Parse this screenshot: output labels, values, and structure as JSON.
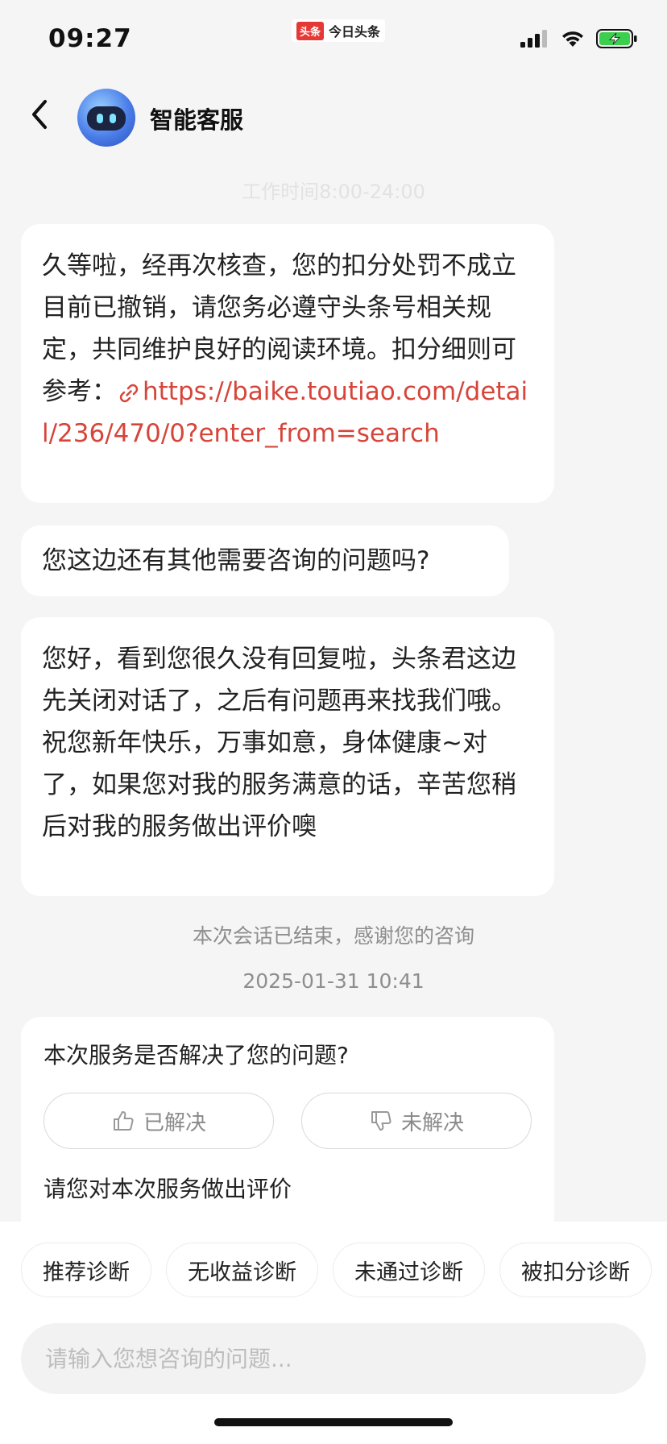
{
  "status_bar": {
    "time": "09:27",
    "app_badge_logo": "头条",
    "app_badge_name": "今日头条",
    "icons": [
      "signal-icon",
      "wifi-icon",
      "battery-charging-icon"
    ],
    "battery_color": "#3ccf4e"
  },
  "header": {
    "title": "智能客服",
    "back_icon": "chevron-left-icon",
    "avatar_icon": "robot-avatar-icon"
  },
  "faded_hint": "工作时间8:00-24:00",
  "messages": [
    {
      "text": "久等啦，经再次核查，您的扣分处罚不成立目前已撤销，请您务必遵守头条号相关规定，共同维护良好的阅读环境。扣分细则可参考：",
      "link": "https://baike.toutiao.com/detail/236/470/0?enter_from=search"
    },
    {
      "text": "您这边还有其他需要咨询的问题吗?"
    },
    {
      "text": "您好，看到您很久没有回复啦，头条君这边先关闭对话了，之后有问题再来找我们哦。祝您新年快乐，万事如意，身体健康~对了，如果您对我的服务满意的话，辛苦您稍后对我的服务做出评价噢"
    }
  ],
  "system": {
    "ended": "本次会话已结束，感谢您的咨询",
    "timestamp": "2025-01-31 10:41"
  },
  "feedback": {
    "question": "本次服务是否解决了您的问题?",
    "resolved_label": "已解决",
    "unresolved_label": "未解决",
    "rate_prompt": "请您对本次服务做出评价"
  },
  "quick_replies": [
    "推荐诊断",
    "无收益诊断",
    "未通过诊断",
    "被扣分诊断"
  ],
  "input": {
    "placeholder": "请输入您想咨询的问题...",
    "value": ""
  },
  "colors": {
    "link": "#d6453a",
    "background": "#f5f5f5",
    "bubble": "#ffffff"
  }
}
